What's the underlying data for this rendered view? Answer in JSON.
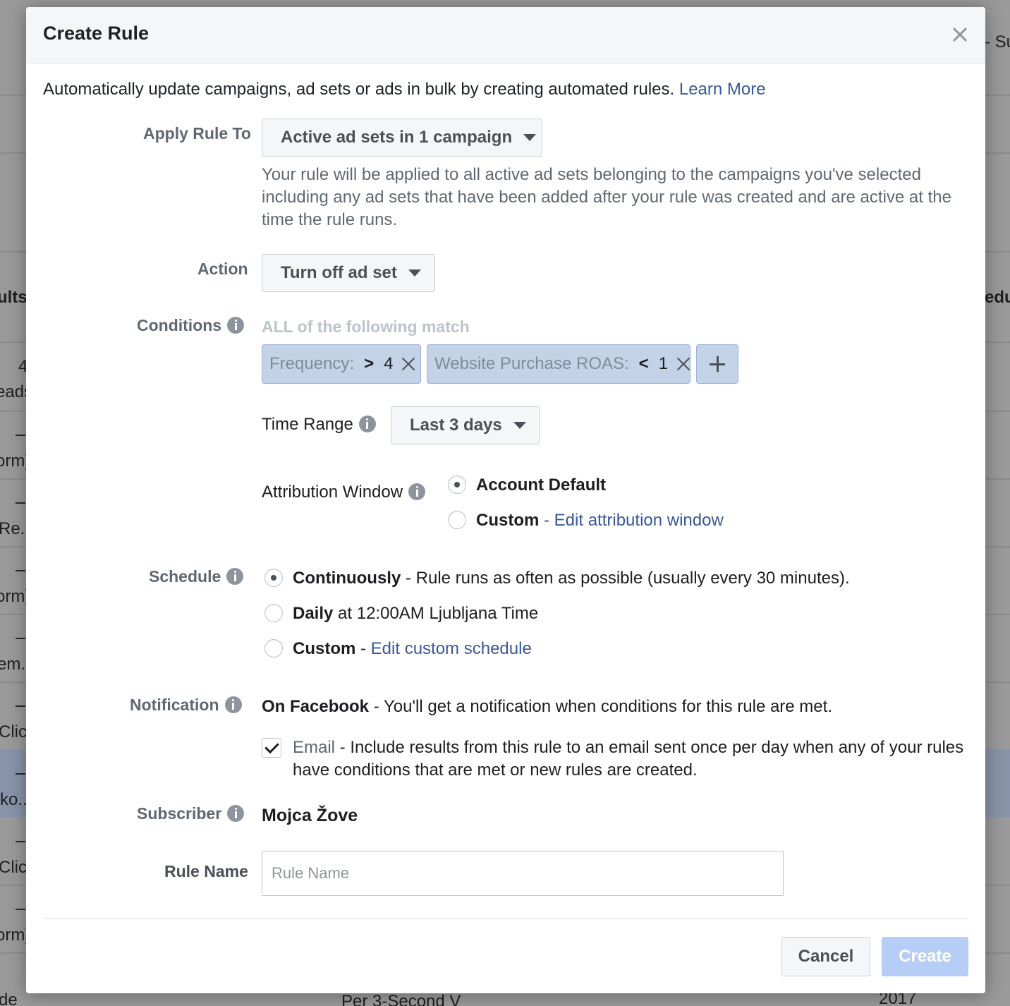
{
  "background": {
    "right_top_fragment": "- Su",
    "left_header_fragment": "ults",
    "right_header_fragment": "edu",
    "left_fragments": [
      "4",
      "eads",
      "orm)",
      "Re...",
      "orm)",
      "em...",
      "Click",
      "ko...",
      "Click",
      "orm)",
      "de"
    ],
    "bottom_fragments": [
      "Per 3-Second V",
      "2017"
    ]
  },
  "modal": {
    "title": "Create Rule",
    "intro_text": "Automatically update campaigns, ad sets or ads in bulk by creating automated rules.",
    "learn_more": "Learn More"
  },
  "apply_rule": {
    "label": "Apply Rule To",
    "value": "Active ad sets in 1 campaign",
    "help": "Your rule will be applied to all active ad sets belonging to the campaigns you've selected including any ad sets that have been added after your rule was created and are active at the time the rule runs."
  },
  "action": {
    "label": "Action",
    "value": "Turn off ad set"
  },
  "conditions": {
    "label": "Conditions",
    "heading": "ALL of the following match",
    "items": [
      {
        "metric": "Frequency:",
        "operator": ">",
        "value": "4"
      },
      {
        "metric": "Website Purchase ROAS:",
        "operator": "<",
        "value": "1"
      }
    ],
    "time_range_label": "Time Range",
    "time_range_value": "Last 3 days",
    "attribution_label": "Attribution Window",
    "attribution_options": [
      {
        "title": "Account Default",
        "selected": true
      },
      {
        "title": "Custom",
        "link": "- Edit attribution window",
        "selected": false
      }
    ]
  },
  "schedule": {
    "label": "Schedule",
    "options": [
      {
        "title": "Continuously",
        "desc": " - Rule runs as often as possible (usually every 30 minutes).",
        "selected": true
      },
      {
        "title": "Daily",
        "desc": " at 12:00AM Ljubljana Time",
        "selected": false
      },
      {
        "title": "Custom",
        "desc": " - ",
        "link": "Edit custom schedule",
        "selected": false
      }
    ]
  },
  "notification": {
    "label": "Notification",
    "facebook_title": "On Facebook",
    "facebook_desc": " - You'll get a notification when conditions for this rule are met.",
    "email_title": "Email",
    "email_desc": " - Include results from this rule to an email sent once per day when any of your rules have conditions that are met or new rules are created.",
    "email_checked": true
  },
  "subscriber": {
    "label": "Subscriber",
    "name": "Mojca Žove"
  },
  "rule_name": {
    "label": "Rule Name",
    "placeholder": "Rule Name",
    "value": ""
  },
  "footer": {
    "cancel": "Cancel",
    "create": "Create"
  },
  "colors": {
    "link": "#385898",
    "create_button_disabled": "#b6cdf5",
    "chip_background": "#c4d2e7"
  }
}
